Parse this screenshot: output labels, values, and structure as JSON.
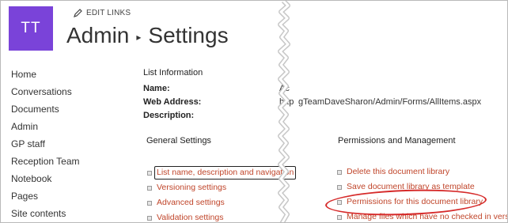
{
  "site": {
    "avatar_initials": "TT",
    "edit_links": "EDIT LINKS",
    "title_part1": "Admin",
    "title_sep": "▸",
    "title_part2": "Settings"
  },
  "left_nav": [
    "Home",
    "Conversations",
    "Documents",
    "Admin",
    "GP staff",
    "Reception Team",
    "Notebook",
    "Pages",
    "Site contents"
  ],
  "list_information": {
    "heading": "List Information",
    "name_label": "Name:",
    "name_value": "Ac",
    "web_address_label": "Web Address:",
    "web_address_value": "http",
    "web_address_value_right": "gTeamDaveSharon/Admin/Forms/AllItems.aspx",
    "description_label": "Description:"
  },
  "general_settings": {
    "heading": "General Settings",
    "items": [
      "List name, description and navigation",
      "Versioning settings",
      "Advanced settings",
      "Validation settings"
    ]
  },
  "permissions_management": {
    "heading": "Permissions and Management",
    "items": [
      "Delete this document library",
      "Save document library as template",
      "Permissions for this document library",
      "Manage files which have no checked in version"
    ]
  },
  "colors": {
    "avatar_bg": "#7a43d9",
    "link": "#c0452a",
    "highlight_oval": "#d62a2a"
  }
}
